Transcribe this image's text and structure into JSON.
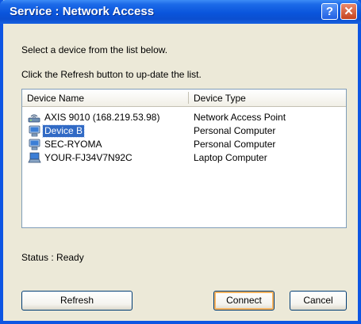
{
  "window": {
    "title": "Service : Network Access",
    "help_glyph": "?",
    "close_glyph": "✕"
  },
  "instructions": {
    "line1": "Select a device from the list below.",
    "line2": "Click the Refresh button to up-date the list."
  },
  "list": {
    "columns": [
      "Device Name",
      "Device Type"
    ],
    "rows": [
      {
        "name": "AXIS 9010 (168.219.53.98)",
        "type": "Network Access Point",
        "icon": "access-point-icon",
        "selected": false
      },
      {
        "name": "Device B",
        "type": "Personal Computer",
        "icon": "computer-icon",
        "selected": true
      },
      {
        "name": "SEC-RYOMA",
        "type": "Personal Computer",
        "icon": "computer-icon",
        "selected": false
      },
      {
        "name": "YOUR-FJ34V7N92C",
        "type": "Laptop Computer",
        "icon": "laptop-icon",
        "selected": false
      }
    ]
  },
  "status": {
    "text": "Status : Ready"
  },
  "buttons": {
    "refresh": "Refresh",
    "connect": "Connect",
    "cancel": "Cancel"
  },
  "colors": {
    "titlebar": "#0a55dc",
    "dialog_bg": "#ece9d8",
    "selection": "#316ac5"
  }
}
